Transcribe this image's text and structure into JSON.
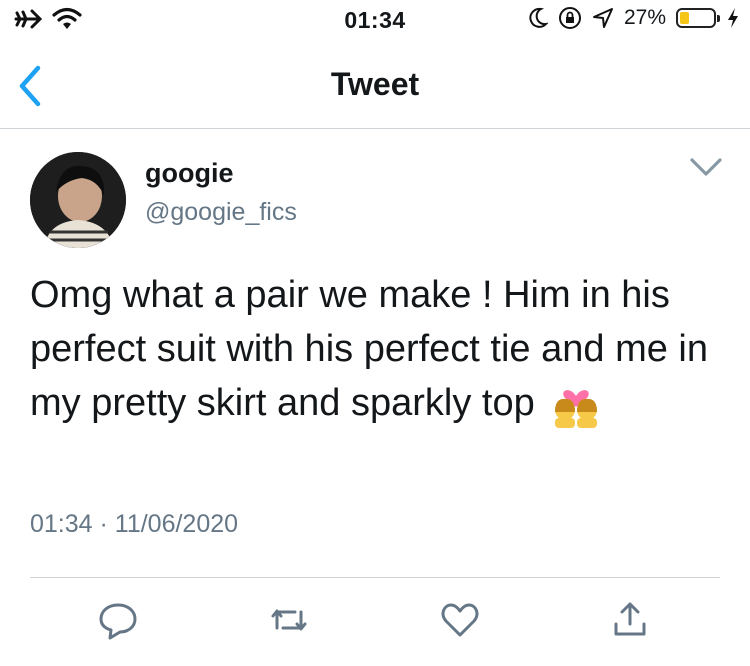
{
  "status_bar": {
    "time": "01:34",
    "battery_percent": "27%",
    "battery_level": 0.27,
    "icons": [
      "airplane-icon",
      "wifi-icon",
      "moon-icon",
      "orientation-lock-icon",
      "location-icon",
      "battery-icon",
      "charging-icon"
    ]
  },
  "nav": {
    "title": "Tweet",
    "back_icon": "chevron-left-icon"
  },
  "tweet": {
    "author_name": "googie",
    "author_handle": "@googie_fics",
    "text": "Omg what a pair we make ! Him in his perfect suit with his perfect tie and me in my pretty skirt and sparkly top",
    "emoji": "couple-with-heart-icon",
    "timestamp": "01:34 · 11/06/2020"
  },
  "actions": [
    "reply-icon",
    "retweet-icon",
    "like-icon",
    "share-icon"
  ],
  "colors": {
    "accent": "#1da1f2",
    "secondary_text": "#657786",
    "icon_gray": "#657786",
    "battery_fill": "#f5c518"
  }
}
